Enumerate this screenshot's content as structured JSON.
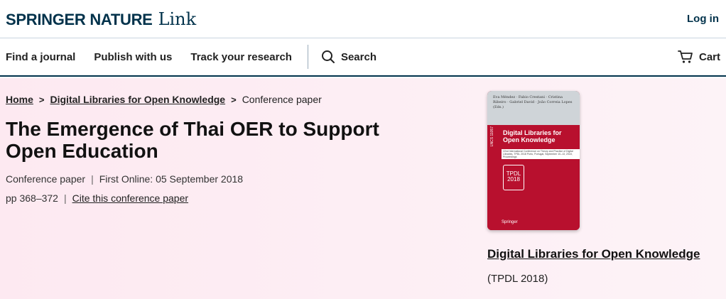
{
  "header": {
    "brand_main": "SPRINGER NATURE",
    "brand_sub": "Link",
    "login": "Log in"
  },
  "nav": {
    "items": [
      "Find a journal",
      "Publish with us",
      "Track your research"
    ],
    "search": "Search",
    "cart": "Cart"
  },
  "breadcrumb": {
    "home": "Home",
    "book": "Digital Libraries for Open Knowledge",
    "current": "Conference paper"
  },
  "article": {
    "title": "The Emergence of Thai OER to Support Open Education",
    "type": "Conference paper",
    "first_online": "First Online: 05 September 2018",
    "pages": "pp 368–372",
    "cite": "Cite this conference paper"
  },
  "book": {
    "cover_editors": "Eva Méndez · Fabio Crestani · Cristina Ribeiro · Gabriel David · João Correia Lopes (Eds.)",
    "cover_title": "Digital Libraries for Open Knowledge",
    "cover_band": "22nd International Conference on Theory and Practice of Digital Libraries, TPDL 2018 Porto, Portugal, September 10–13, 2018, Proceedings",
    "cover_series": "LNCS 11057",
    "cover_logo": "TPDL 2018",
    "cover_publisher": "Springer",
    "title": "Digital Libraries for Open Knowledge",
    "subtitle": "(TPDL 2018)"
  },
  "colors": {
    "brand": "#01324b",
    "cover_red": "#b8102e",
    "hero_bg": "#fde9f1"
  }
}
